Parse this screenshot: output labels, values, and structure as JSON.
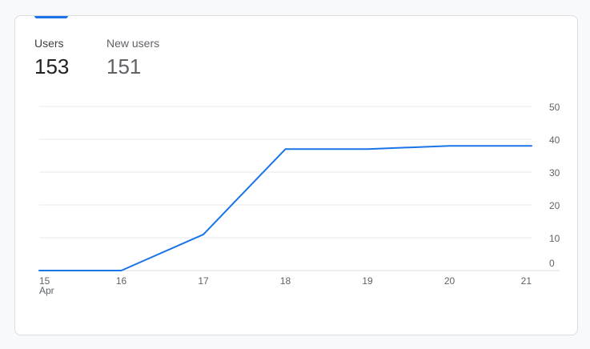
{
  "metrics": [
    {
      "label": "Users",
      "value": "153"
    },
    {
      "label": "New users",
      "value": "151"
    }
  ],
  "colors": {
    "accent": "#1a73e8",
    "line": "#1a73e8",
    "grid": "#e8eaed"
  },
  "chart_data": {
    "type": "line",
    "x": [
      "15",
      "16",
      "17",
      "18",
      "19",
      "20",
      "21"
    ],
    "x_sub": [
      "Apr",
      "",
      "",
      "",
      "",
      "",
      ""
    ],
    "series": [
      {
        "values": [
          0,
          0,
          11,
          37,
          37,
          38,
          38
        ]
      }
    ],
    "yticks": [
      0,
      10,
      20,
      30,
      40,
      50
    ],
    "ylim": [
      0,
      50
    ],
    "y_axis_side": "right",
    "grid": true,
    "title": "",
    "xlabel": "",
    "ylabel": ""
  }
}
